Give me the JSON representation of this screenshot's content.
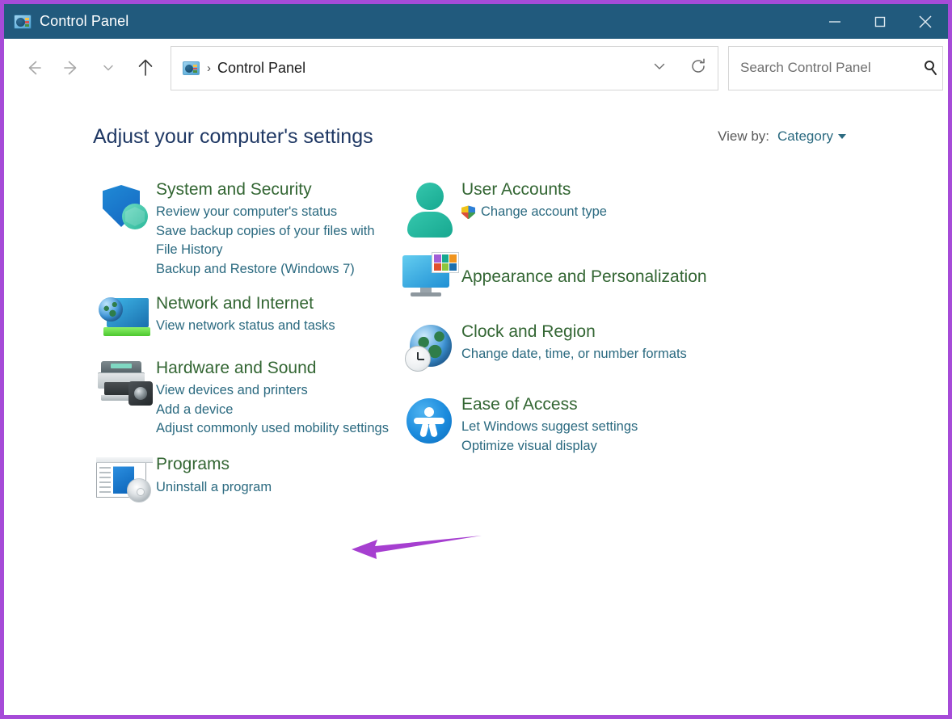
{
  "window": {
    "title": "Control Panel",
    "app_icon": "control-panel-icon",
    "controls": {
      "minimize": "minimize-icon",
      "maximize": "maximize-icon",
      "close": "close-icon"
    },
    "titlebar_color": "#215a7d",
    "annotation_border_color": "#a64bd8"
  },
  "toolbar": {
    "back": "back-arrow-icon",
    "forward": "forward-arrow-icon",
    "recent": "chevron-down-icon",
    "up": "up-arrow-icon",
    "address": {
      "icon": "control-panel-icon",
      "separator": "›",
      "crumb": "Control Panel",
      "dropdown": "chevron-down-icon",
      "refresh": "refresh-icon"
    },
    "search": {
      "placeholder": "Search Control Panel",
      "value": "",
      "icon": "search-icon"
    }
  },
  "page": {
    "title": "Adjust your computer's settings",
    "view_by_label": "View by:",
    "view_by_value": "Category",
    "view_by_caret": "caret-down-icon",
    "title_color": "#1f3864",
    "category_color": "#336633",
    "link_color": "#2b6a80"
  },
  "categories": {
    "left": [
      {
        "icon": "shield-icon",
        "title": "System and Security",
        "links": [
          "Review your computer's status",
          "Save backup copies of your files with File History",
          "Backup and Restore (Windows 7)"
        ]
      },
      {
        "icon": "network-monitor-globe-icon",
        "title": "Network and Internet",
        "links": [
          "View network status and tasks"
        ]
      },
      {
        "icon": "printer-camera-icon",
        "title": "Hardware and Sound",
        "links": [
          "View devices and printers",
          "Add a device",
          "Adjust commonly used mobility settings"
        ]
      },
      {
        "icon": "programs-disc-icon",
        "title": "Programs",
        "links": [
          "Uninstall a program"
        ]
      }
    ],
    "right": [
      {
        "icon": "user-account-icon",
        "title": "User Accounts",
        "links": [
          "Change account type"
        ],
        "link_badge": "uac-shield-icon"
      },
      {
        "icon": "appearance-monitor-icon",
        "title": "Appearance and Personalization",
        "links": []
      },
      {
        "icon": "clock-globe-icon",
        "title": "Clock and Region",
        "links": [
          "Change date, time, or number formats"
        ]
      },
      {
        "icon": "ease-of-access-icon",
        "title": "Ease of Access",
        "links": [
          "Let Windows suggest settings",
          "Optimize visual display"
        ]
      }
    ]
  },
  "annotation": {
    "type": "arrow",
    "color": "#a63fd0",
    "points_to": "Hardware and Sound",
    "direction": "left"
  }
}
